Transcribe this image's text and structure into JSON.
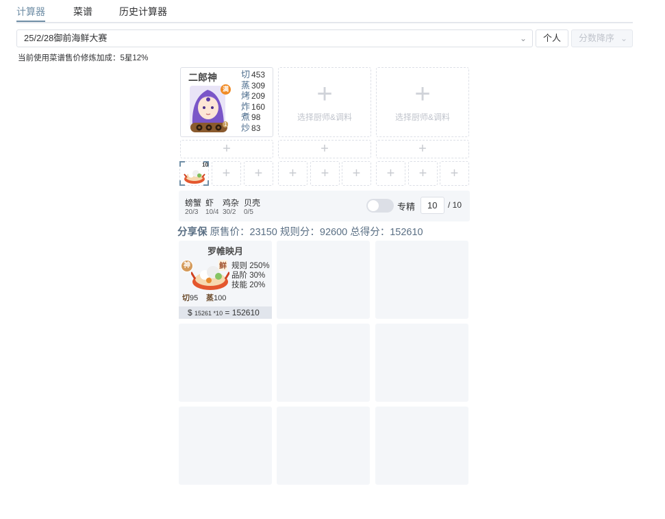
{
  "tabs": [
    {
      "label": "计算器",
      "active": true
    },
    {
      "label": "菜谱",
      "active": false
    },
    {
      "label": "历史计算器",
      "active": false
    }
  ],
  "toolbar": {
    "rule_value": "25/2/28御前海鲜大赛",
    "personal_label": "个人",
    "sort_placeholder": "分数降序"
  },
  "info_text": "当前使用菜谱售价修炼加成：5星12%",
  "chef": {
    "name": "二郎神",
    "badge_text": "满",
    "level_text": "1",
    "skills": [
      {
        "k": "切",
        "v": "453"
      },
      {
        "k": "蒸",
        "v": "309"
      },
      {
        "k": "烤",
        "v": "209"
      },
      {
        "k": "炸",
        "v": "160"
      },
      {
        "k": "煮",
        "v": "98"
      },
      {
        "k": "炒",
        "v": "83"
      }
    ]
  },
  "empty_chef_label": "选择厨师&调料",
  "dish_slot_count": "10",
  "ingredients": [
    {
      "name": "螃蟹",
      "amount": "20/3"
    },
    {
      "name": "虾",
      "amount": "10/4"
    },
    {
      "name": "鸡杂",
      "amount": "30/2"
    },
    {
      "name": "贝壳",
      "amount": "0/5"
    }
  ],
  "toggle_label": "专精",
  "quantity": {
    "value": "10",
    "total": "/ 10"
  },
  "score": {
    "prefix": "分享保",
    "text": "原售价：23150 规则分：92600 总得分：152610"
  },
  "result": {
    "title": "罗帷映月",
    "badge_left": "神",
    "badge_right": "鲜",
    "stats": [
      "规则 250%",
      "品阶 30%",
      "技能 20%"
    ],
    "skills": [
      {
        "k": "切",
        "v": "95"
      },
      {
        "k": "蒸",
        "v": "100"
      }
    ],
    "price_symbol": "$",
    "price_small": "15261 *10",
    "price_total": "= 152610"
  },
  "colors": {
    "accent": "#6f8ea6",
    "panel": "#f4f6f9",
    "border": "#dcdfe6"
  }
}
